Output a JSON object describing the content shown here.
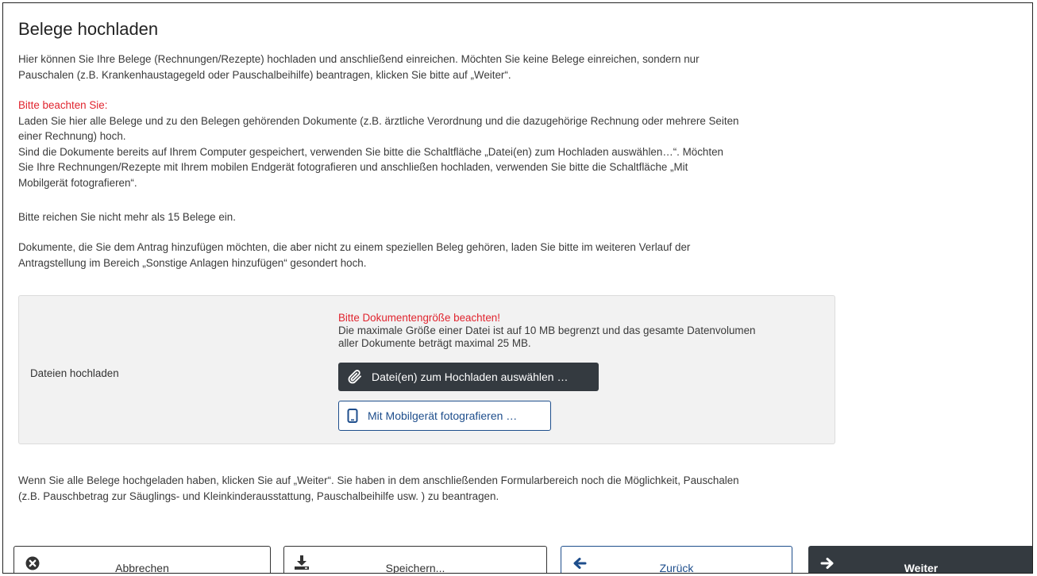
{
  "page": {
    "title": "Belege hochladen",
    "intro_1": "Hier können Sie Ihre Belege (Rechnungen/Rezepte) hochladen und anschließend einreichen. Möchten Sie keine Belege einreichen, sondern nur",
    "intro_2": "Pauschalen (z.B. Krankenhaustagegeld oder Pauschalbeihilfe) beantragen, klicken Sie bitte auf „Weiter“.",
    "notice_heading": "Bitte beachten Sie:",
    "notice_1": "Laden Sie hier alle Belege und zu den Belegen gehörenden Dokumente (z.B. ärztliche Verordnung und die dazugehörige Rechnung oder mehrere Seiten",
    "notice_2": "einer Rechnung) hoch.",
    "notice_3": "Sind die Dokumente bereits auf Ihrem Computer gespeichert, verwenden Sie bitte die Schaltfläche „Datei(en) zum Hochladen auswählen…“. Möchten",
    "notice_4": "Sie Ihre Rechnungen/Rezepte mit Ihrem mobilen Endgerät fotografieren und anschließen hochladen, verwenden Sie bitte die Schaltfläche „Mit",
    "notice_5": "Mobilgerät fotografieren“.",
    "limit_text": "Bitte reichen Sie nicht mehr als 15 Belege ein.",
    "other_docs_1": "Dokumente, die Sie dem Antrag hinzufügen möchten, die aber nicht zu einem speziellen Beleg gehören, laden Sie bitte im weiteren Verlauf der",
    "other_docs_2": "Antragstellung im Bereich „Sonstige Anlagen hinzufügen“ gesondert hoch.",
    "footer_1": "Wenn Sie alle Belege hochgeladen haben, klicken Sie auf „Weiter“. Sie haben in dem anschließenden Formularbereich noch die Möglichkeit, Pauschalen",
    "footer_2": "(z.B. Pauschbetrag zur Säuglings- und Kleinkinderausstattung, Pauschalbeihilfe usw. ) zu beantragen."
  },
  "upload": {
    "label": "Dateien hochladen",
    "warning": "Bitte Dokumentengröße beachten!",
    "info_1": "Die maximale Größe einer Datei ist auf 10 MB begrenzt und das gesamte Datenvolumen",
    "info_2": "aller Dokumente beträgt maximal 25 MB.",
    "select_files_button": "Datei(en) zum Hochladen auswählen …",
    "mobile_button": "Mit Mobilgerät fotografieren …"
  },
  "nav": {
    "cancel": "Abbrechen",
    "save": "Speichern...",
    "back": "Zurück",
    "next": "Weiter"
  },
  "colors": {
    "warning_red": "#e0242e",
    "primary_dark": "#343a40",
    "link_blue": "#1e4e8c",
    "panel_bg": "#f2f2f2"
  },
  "icons": {
    "select_files": "paperclip-icon",
    "mobile": "mobile-phone-icon",
    "cancel": "times-circle-icon",
    "save": "download-icon",
    "back": "arrow-left-icon",
    "next": "arrow-right-icon"
  }
}
